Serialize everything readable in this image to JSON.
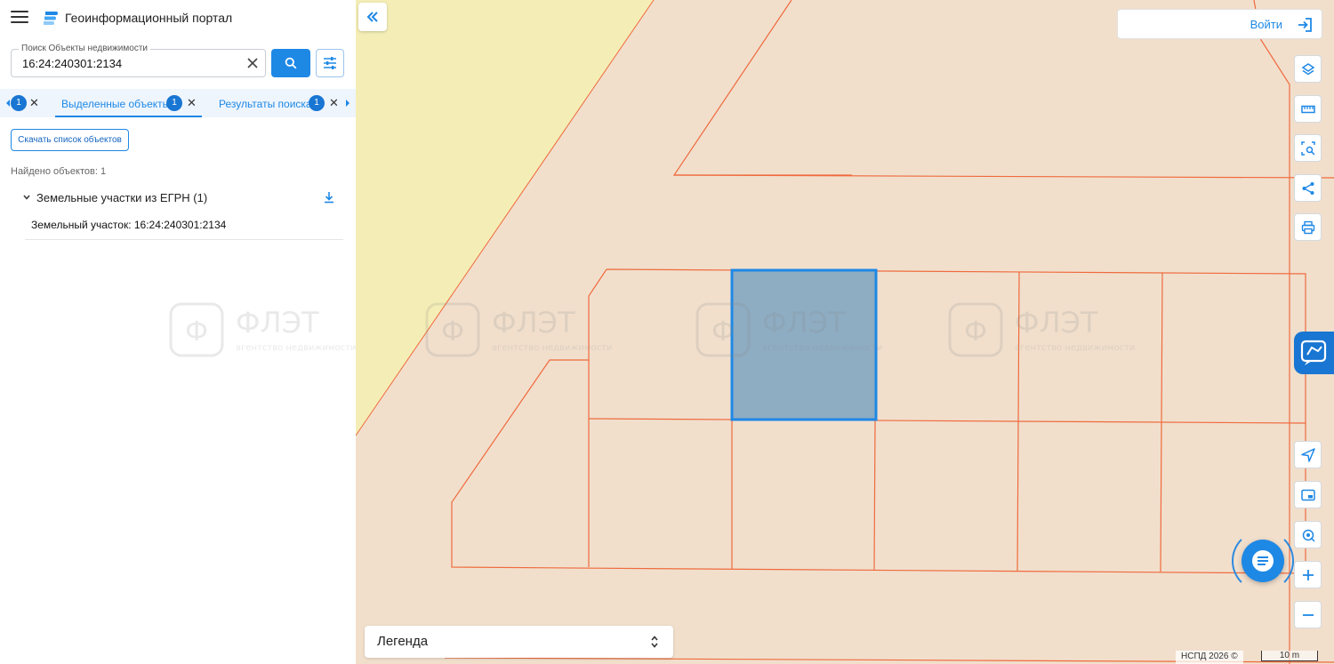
{
  "header": {
    "title": "Геоинформационный портал"
  },
  "search": {
    "label": "Поиск Объекты недвижимости",
    "value": "16:24:240301:2134"
  },
  "tabs": {
    "partial_badge": "1",
    "items": [
      {
        "label": "Выделенные объекты",
        "badge": "1",
        "active": true
      },
      {
        "label": "Результаты поиска",
        "badge": "1",
        "active": false
      }
    ]
  },
  "results": {
    "download_button": "Скачать список объектов",
    "found": "Найдено объектов: 1",
    "group_title": "Земельные участки из ЕГРН (1)",
    "items": [
      {
        "label": "Земельный участок: 16:24:240301:2134"
      }
    ]
  },
  "map": {
    "login_label": "Войти",
    "legend_label": "Легенда",
    "attribution": "НСПД 2026 ©",
    "scale_label": "10 m",
    "colors": {
      "land": "#f1dfcc",
      "zone": "#f4eeb6",
      "boundary": "#f06a3d",
      "selected_fill": "#8eacc2",
      "selected_stroke": "#1e88e5",
      "accent": "#1e88e5"
    }
  },
  "watermark": {
    "brand": "ФЛЭТ",
    "tagline": "агентство недвижимости"
  },
  "icons": {
    "menu": "menu-icon",
    "logo": "portal-logo-icon",
    "clear": "close-icon",
    "search": "search-icon",
    "filter": "filter-sliders-icon",
    "collapse": "double-chevron-left-icon",
    "login": "login-icon",
    "layers": "layers-icon",
    "ruler": "ruler-icon",
    "select_area": "area-select-icon",
    "share": "share-icon",
    "print": "printer-icon",
    "support": "support-icon",
    "locate": "navigation-arrow-icon",
    "map_frame": "minimap-icon",
    "geolocation": "geolocation-icon",
    "zoom_in": "plus-icon",
    "zoom_out": "minus-icon",
    "chat": "chat-icon"
  }
}
